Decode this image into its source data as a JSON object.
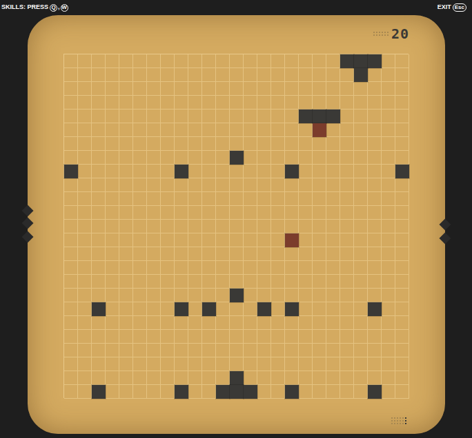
{
  "top_bar": {
    "skills_label": "SKILLS: PRESS",
    "keys": [
      "Q",
      "W"
    ],
    "exit_label": "EXIT",
    "exit_key": "Esc"
  },
  "board": {
    "counter": "20",
    "blocks": [
      {
        "col": 20,
        "row": 0,
        "kind": "wall",
        "color": "#3a3936"
      },
      {
        "col": 21,
        "row": 0,
        "kind": "wall",
        "color": "#3a3936"
      },
      {
        "col": 22,
        "row": 0,
        "kind": "wall",
        "color": "#3a3936"
      },
      {
        "col": 21,
        "row": 1,
        "kind": "wall",
        "color": "#3a3936"
      },
      {
        "col": 17,
        "row": 4,
        "kind": "wall",
        "color": "#3a3936"
      },
      {
        "col": 18,
        "row": 4,
        "kind": "wall",
        "color": "#3a3936"
      },
      {
        "col": 19,
        "row": 4,
        "kind": "wall",
        "color": "#3a3936"
      },
      {
        "col": 18,
        "row": 5,
        "kind": "target",
        "color": "#7b3c2c"
      },
      {
        "col": 12,
        "row": 7,
        "kind": "wall",
        "color": "#3a3936"
      },
      {
        "col": 0,
        "row": 8,
        "kind": "wall",
        "color": "#3a3936"
      },
      {
        "col": 8,
        "row": 8,
        "kind": "wall",
        "color": "#3a3936"
      },
      {
        "col": 16,
        "row": 8,
        "kind": "wall",
        "color": "#3a3936"
      },
      {
        "col": 24,
        "row": 8,
        "kind": "wall",
        "color": "#3a3936"
      },
      {
        "col": 16,
        "row": 13,
        "kind": "target",
        "color": "#7b3c2c"
      },
      {
        "col": 12,
        "row": 17,
        "kind": "wall",
        "color": "#3a3936"
      },
      {
        "col": 2,
        "row": 18,
        "kind": "wall",
        "color": "#3a3936"
      },
      {
        "col": 8,
        "row": 18,
        "kind": "wall",
        "color": "#3a3936"
      },
      {
        "col": 10,
        "row": 18,
        "kind": "wall",
        "color": "#3a3936"
      },
      {
        "col": 14,
        "row": 18,
        "kind": "wall",
        "color": "#3a3936"
      },
      {
        "col": 16,
        "row": 18,
        "kind": "wall",
        "color": "#3a3936"
      },
      {
        "col": 22,
        "row": 18,
        "kind": "wall",
        "color": "#3a3936"
      },
      {
        "col": 12,
        "row": 23,
        "kind": "wall",
        "color": "#3a3936"
      },
      {
        "col": 2,
        "row": 24,
        "kind": "wall",
        "color": "#3a3936"
      },
      {
        "col": 8,
        "row": 24,
        "kind": "wall",
        "color": "#3a3936"
      },
      {
        "col": 11,
        "row": 24,
        "kind": "wall",
        "color": "#3a3936"
      },
      {
        "col": 12,
        "row": 24,
        "kind": "wall",
        "color": "#3a3936"
      },
      {
        "col": 13,
        "row": 24,
        "kind": "wall",
        "color": "#3a3936"
      },
      {
        "col": 16,
        "row": 24,
        "kind": "wall",
        "color": "#3a3936"
      },
      {
        "col": 22,
        "row": 24,
        "kind": "wall",
        "color": "#3a3936"
      }
    ]
  }
}
